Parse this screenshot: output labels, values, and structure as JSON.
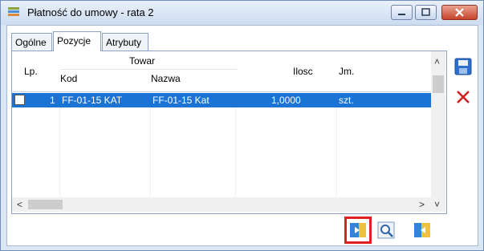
{
  "window": {
    "title": "Płatność do umowy - rata 2",
    "controls": [
      "minimize",
      "maximize",
      "close"
    ]
  },
  "tabs": [
    {
      "label": "Ogólne",
      "active": false
    },
    {
      "label": "Pozycje",
      "active": true
    },
    {
      "label": "Atrybuty",
      "active": false
    }
  ],
  "grid": {
    "headers": {
      "lp": "Lp.",
      "towar": "Towar",
      "kod": "Kod",
      "nazwa": "Nazwa",
      "ilosc": "Ilosc",
      "jm": "Jm."
    },
    "rows": [
      {
        "lp": "1",
        "kod": "FF-01-15 KAT",
        "nazwa": "FF-01-15 Kat",
        "ilosc": "1,0000",
        "jm": "szt.",
        "selected": true
      }
    ]
  },
  "side_buttons": [
    "save-icon",
    "delete-icon"
  ],
  "bottom_buttons": [
    "export-icon",
    "search-icon",
    "import-icon"
  ],
  "colors": {
    "selection": "#1b73d3",
    "highlight_outline": "#e02020",
    "delete_red": "#d42020"
  }
}
